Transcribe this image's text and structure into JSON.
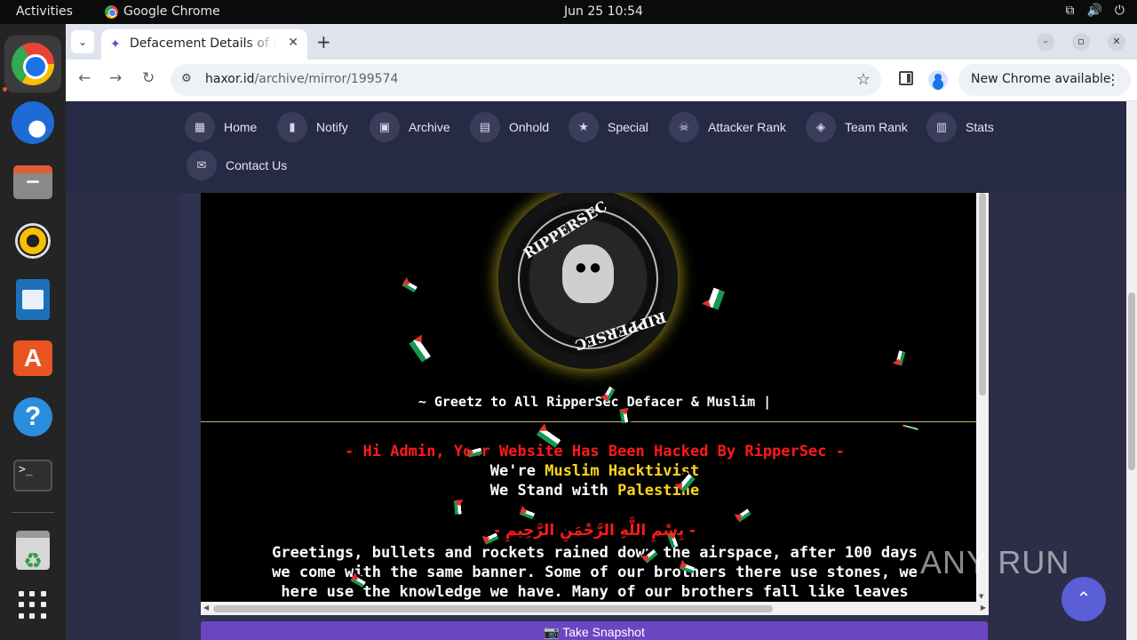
{
  "topbar": {
    "activities": "Activities",
    "app": "Google Chrome",
    "clock": "Jun 25  10:54"
  },
  "dock": {
    "items": [
      "chrome-icon",
      "thunderbird-icon",
      "files-icon",
      "rhythmbox-icon",
      "writer-icon",
      "app-center-icon",
      "help-icon",
      "terminal-icon",
      "trash-icon",
      "show-apps-icon"
    ]
  },
  "browser": {
    "tab_title": "Defacement Details of b",
    "url_host": "haxor.id",
    "url_path": "/archive/mirror/199574",
    "update_label": "New Chrome available"
  },
  "site": {
    "nav": [
      "Home",
      "Notify",
      "Archive",
      "Onhold",
      "Special",
      "Attacker Rank",
      "Team Rank",
      "Stats",
      "Contact Us"
    ],
    "snapshot_label": "Take Snapshot"
  },
  "mirror": {
    "logo_text_top": "RIPPERSEC",
    "logo_text_bottom": "RIPPERSEC",
    "greetz": "~ Greetz to All RipperSec Defacer & Muslim |",
    "hacked_line": "- Hi Admin, Your Website Has Been Hacked By RipperSec -",
    "were": "We're",
    "hacktivist": "Muslim Hacktivist",
    "we_stand": "We Stand with",
    "palestine": "Palestine",
    "basmala": "- بِسْمِ اللَّهِ الرَّحْمَنِ الرَّحِيمِ -",
    "para_line1": "Greetings, bullets and rockets rained down the airspace, after 100 days",
    "para_line2": "we come with the same banner. Some of our brothers there use stones, we",
    "para_line3": "here use the knowledge we have. Many of our brothers fall like leaves"
  },
  "watermark": "ANY RUN",
  "colors": {
    "site_bg": "#2c2e47",
    "nav_bg": "#272a45",
    "snapshot": "#6b46c1",
    "hacked_red": "#ff1a1a",
    "highlight_yellow": "#ffd61a"
  }
}
